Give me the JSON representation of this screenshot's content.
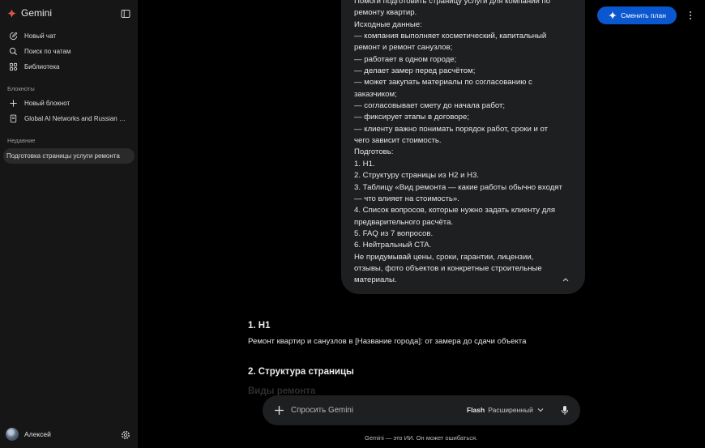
{
  "app": {
    "name": "Gemini"
  },
  "sidebar": {
    "nav": [
      {
        "label": "Новый чат",
        "icon": "edit-icon"
      },
      {
        "label": "Поиск по чатам",
        "icon": "search-icon"
      },
      {
        "label": "Библиотека",
        "icon": "library-icon"
      }
    ],
    "notebooks_title": "Блокноты",
    "notebooks": [
      {
        "label": "Новый блокнот",
        "icon": "plus-icon"
      },
      {
        "label": "Global AI Networks and Russian E...",
        "icon": "notebook-icon"
      }
    ],
    "recent_title": "Недавние",
    "recent": [
      {
        "label": "Подготовка страницы услуги ремонта",
        "active": true
      }
    ],
    "user_name": "Алексей"
  },
  "header": {
    "upgrade_label": "Сменить план"
  },
  "prompt": {
    "lines": [
      "Помоги подготовить страницу услуги для компании по",
      "ремонту квартир.",
      "Исходные данные:",
      "— компания выполняет косметический, капитальный",
      "ремонт и ремонт санузлов;",
      "— работает в одном городе;",
      "— делает замер перед расчётом;",
      "— может закупать материалы по согласованию с",
      "заказчиком;",
      "— согласовывает смету до начала работ;",
      "— фиксирует этапы в договоре;",
      "— клиенту важно понимать порядок работ, сроки и от",
      "чего зависит стоимость.",
      "Подготовь:",
      "1. H1.",
      "2. Структуру страницы из H2 и H3.",
      "3. Таблицу «Вид ремонта — какие работы обычно входят",
      "— что влияет на стоимость».",
      "4. Список вопросов, которые нужно задать клиенту для",
      "предварительного расчёта.",
      "5. FAQ из 7 вопросов.",
      "6. Нейтральный CTA.",
      "Не придумывай цены, сроки, гарантии, лицензии,",
      "отзывы, фото объектов и конкретные строительные",
      "материалы."
    ]
  },
  "response": {
    "h1_title": "1. H1",
    "h1_text": "Ремонт квартир и санузлов в [Название города]: от замера до сдачи объекта",
    "h2_title": "2. Структура страницы",
    "faded_text": "Виды ремонта"
  },
  "input": {
    "placeholder": "Спросить Gemini",
    "model_name": "Flash",
    "model_mode": "Расширенный"
  },
  "footer": {
    "disclaimer": "Gemini — это ИИ. Он может ошибаться."
  },
  "colors": {
    "accent": "#0b57d0",
    "sidebar_bg": "#161616",
    "bubble_bg": "#1e1f20"
  }
}
